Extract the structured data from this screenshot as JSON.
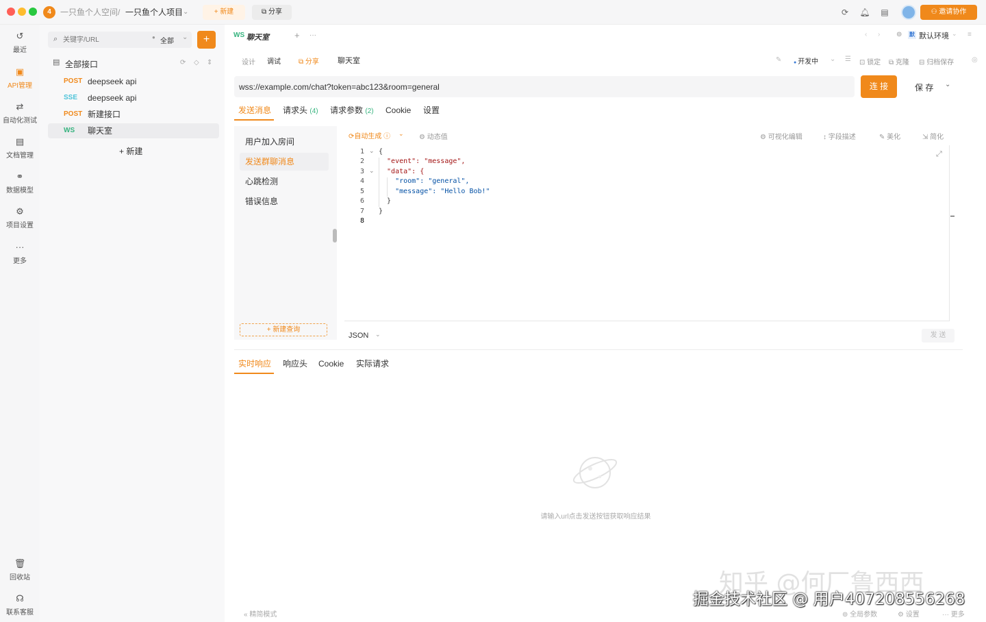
{
  "titlebar": {
    "workspace": "一只鱼个人空间",
    "separator": "/",
    "project": "一只鱼个人项目",
    "new_label": "新建",
    "share_label": "分享",
    "invite_label": "邀请协作",
    "logo_glyph": "4"
  },
  "leftnav": {
    "items": [
      {
        "label": "最近",
        "icon": "history-icon"
      },
      {
        "label": "API管理",
        "icon": "api-icon"
      },
      {
        "label": "自动化测试",
        "icon": "automation-icon"
      },
      {
        "label": "文档管理",
        "icon": "document-icon"
      },
      {
        "label": "数据模型",
        "icon": "data-model-icon"
      },
      {
        "label": "项目设置",
        "icon": "settings-icon"
      },
      {
        "label": "更多",
        "icon": "more-icon"
      }
    ],
    "bottom": [
      {
        "label": "回收站",
        "icon": "trash-icon"
      },
      {
        "label": "联系客服",
        "icon": "headset-icon"
      }
    ]
  },
  "tree": {
    "search_placeholder": "关键字/URL",
    "filter": "全部",
    "add_label": "+",
    "root": "全部接口",
    "items": [
      {
        "method": "POST",
        "name": "deepseek api",
        "color": "#f0891b"
      },
      {
        "method": "SSE",
        "name": "deepseek api",
        "color": "#4cc3d9"
      },
      {
        "method": "POST",
        "name": "新建接口",
        "color": "#f0891b"
      },
      {
        "method": "WS",
        "name": "聊天室",
        "color": "#36b37e"
      }
    ],
    "new_label": "新建"
  },
  "doc_tab": {
    "prefix": "WS",
    "title": "聊天室",
    "plus": "+",
    "more": "···",
    "env": "默认环境",
    "env_badge": "默"
  },
  "toolbar": {
    "design": "设计",
    "debug": "调试",
    "share": "分享",
    "name": "聊天室",
    "status": "开发中",
    "lock": "锁定",
    "clone": "克隆",
    "archive": "归档保存"
  },
  "request": {
    "url": "wss://example.com/chat?token=abc123&room=general",
    "connect": "连 接",
    "save": "保 存"
  },
  "req_tabs": [
    {
      "label": "发送消息",
      "count": ""
    },
    {
      "label": "请求头",
      "count": "(4)"
    },
    {
      "label": "请求参数",
      "count": "(2)"
    },
    {
      "label": "Cookie",
      "count": ""
    },
    {
      "label": "设置",
      "count": ""
    }
  ],
  "messages": {
    "items": [
      "用户加入房间",
      "发送群聊消息",
      "心跳检测",
      "错误信息"
    ],
    "new_label": "新建查询"
  },
  "editor_toolbar": {
    "auto": "自动生成",
    "dynamic": "动态值",
    "visual": "可视化编辑",
    "fields": "字段描述",
    "beautify": "美化",
    "simplify": "简化"
  },
  "code": {
    "line_numbers": [
      "1",
      "2",
      "3",
      "4",
      "5",
      "6",
      "7",
      "8"
    ],
    "lines": [
      "{",
      "  \"event\": \"message\",",
      "  \"data\": {",
      "    \"room\": \"general\",",
      "    \"message\": \"Hello Bob!\"",
      "  }",
      "}",
      ""
    ]
  },
  "format": "JSON",
  "send": "发 送",
  "resp_tabs": [
    "实时响应",
    "响应头",
    "Cookie",
    "实际请求"
  ],
  "empty_hint": "请输入url点击发送按钮获取响应结果",
  "footer": {
    "compact": "精简模式",
    "global_params": "全局参数",
    "settings": "设置",
    "more": "更多"
  },
  "watermark": {
    "line1": "知乎 @何厂鲁西西",
    "line2": "掘金技术社区 @ 用户407208556268"
  },
  "colors": {
    "accent": "#f0891b",
    "green": "#36b37e",
    "cyan": "#4cc3d9"
  }
}
